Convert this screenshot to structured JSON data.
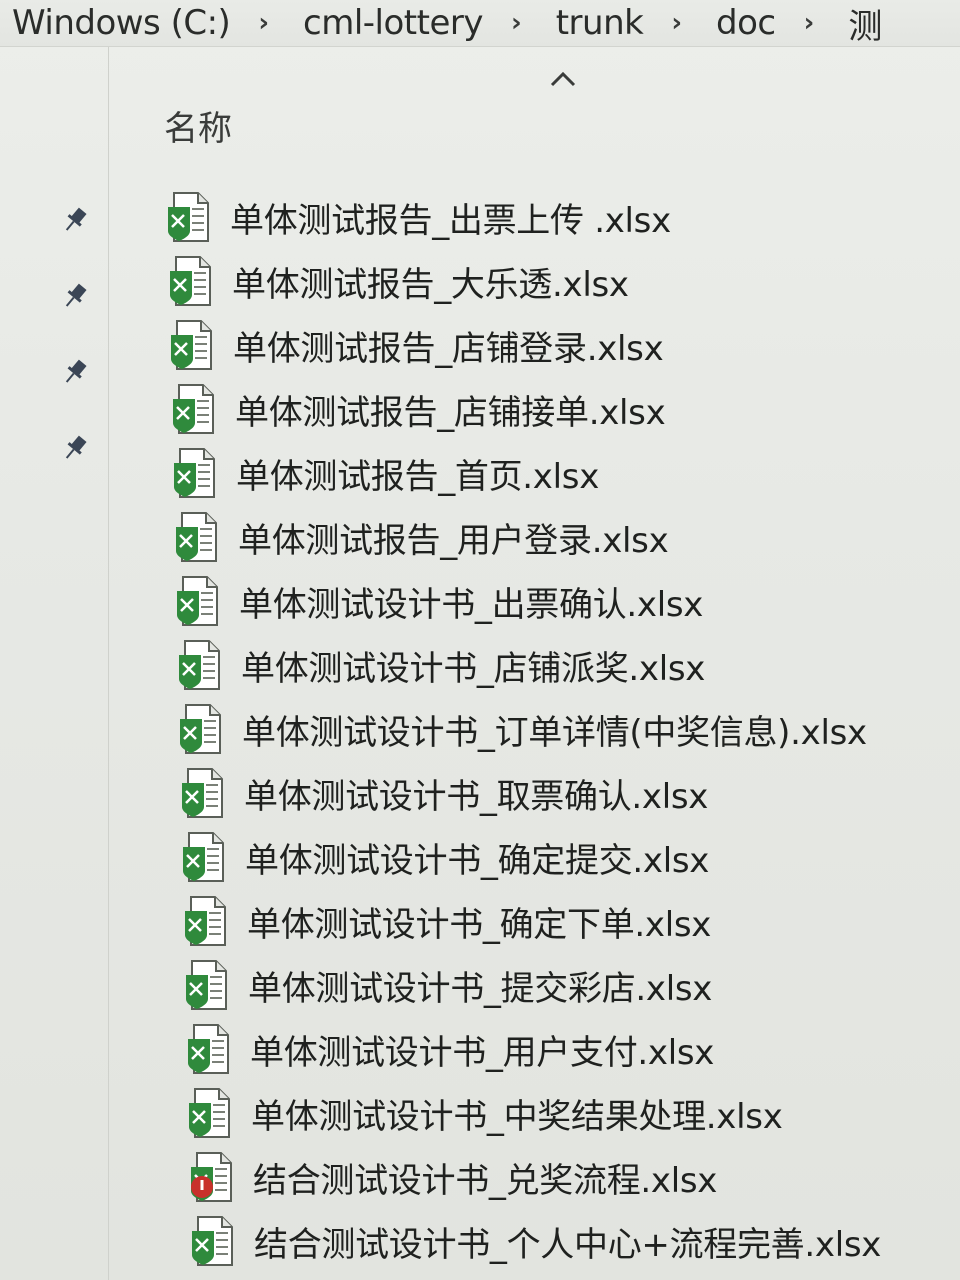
{
  "breadcrumb": {
    "items": [
      "Windows (C:)",
      "cml-lottery",
      "trunk",
      "doc",
      "测"
    ],
    "separator": "›"
  },
  "column_header": {
    "name_label": "名称",
    "sort_indicator": "^"
  },
  "icons": {
    "excel": "excel-file-icon",
    "pin": "pin-icon",
    "error_overlay": "red-error-overlay-icon"
  },
  "colors": {
    "excel_green": "#2f8a3c",
    "error_red": "#c8312b"
  },
  "files": [
    {
      "name": "单体测试报告_出票上传 .xlsx",
      "icon": "excel"
    },
    {
      "name": "单体测试报告_大乐透.xlsx",
      "icon": "excel"
    },
    {
      "name": "单体测试报告_店铺登录.xlsx",
      "icon": "excel"
    },
    {
      "name": "单体测试报告_店铺接单.xlsx",
      "icon": "excel"
    },
    {
      "name": "单体测试报告_首页.xlsx",
      "icon": "excel"
    },
    {
      "name": "单体测试报告_用户登录.xlsx",
      "icon": "excel"
    },
    {
      "name": "单体测试设计书_出票确认.xlsx",
      "icon": "excel"
    },
    {
      "name": "单体测试设计书_店铺派奖.xlsx",
      "icon": "excel"
    },
    {
      "name": "单体测试设计书_订单详情(中奖信息).xlsx",
      "icon": "excel"
    },
    {
      "name": "单体测试设计书_取票确认.xlsx",
      "icon": "excel"
    },
    {
      "name": "单体测试设计书_确定提交.xlsx",
      "icon": "excel"
    },
    {
      "name": "单体测试设计书_确定下单.xlsx",
      "icon": "excel"
    },
    {
      "name": "单体测试设计书_提交彩店.xlsx",
      "icon": "excel"
    },
    {
      "name": "单体测试设计书_用户支付.xlsx",
      "icon": "excel"
    },
    {
      "name": "单体测试设计书_中奖结果处理.xlsx",
      "icon": "excel"
    },
    {
      "name": "结合测试设计书_兑奖流程.xlsx",
      "icon": "excel-error"
    },
    {
      "name": "结合测试设计书_个人中心+流程完善.xlsx",
      "icon": "excel"
    }
  ]
}
